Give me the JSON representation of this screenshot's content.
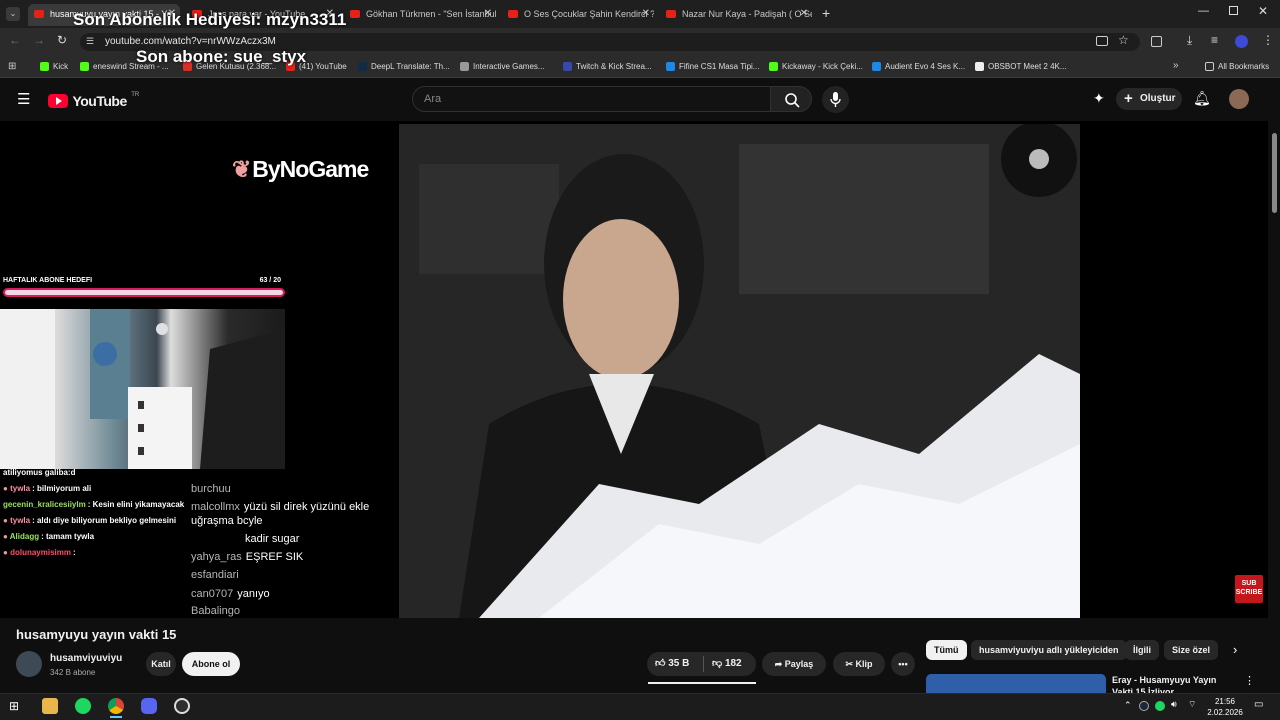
{
  "browser": {
    "tabs": [
      {
        "label": "husamyuyu yayın vakti 15 - Yo"
      },
      {
        "label": "Joss para var - YouTube"
      },
      {
        "label": "Gökhan Türkmen - \"Sen İstanbul"
      },
      {
        "label": "O Ses Çocuklar Şahin Kendirci ?"
      },
      {
        "label": "Nazar Nur Kaya - Padişah ( O Se"
      }
    ],
    "url": "youtube.com/watch?v=nrWWzAczx3M",
    "bookmarks": [
      "Kick",
      "eneswind Stream - ...",
      "Gelen Kutusu (2.368...",
      "(41) YouTube",
      "DeepL Translate: Th...",
      "Interactive Games...",
      "Twitch & Kick Strea...",
      "Fifine CS1 Masa Tipi...",
      "Kickaway - Kick Çeki...",
      "Audient Evo 4 Ses K...",
      "OBSBOT Meet 2 4K..."
    ],
    "all_bookmarks": "All Bookmarks"
  },
  "youtube": {
    "logo_text": "YouTube",
    "logo_region": "TR",
    "search_placeholder": "Ara",
    "create_label": "Oluştur"
  },
  "stream": {
    "overlay_top": "Son Abonelik Hediyesi: mzyn3311",
    "overlay_second": "Son abone: sue_styx",
    "sponsor": "ByNoGame",
    "goal_label": "HAFTALIK ABONE HEDEFI",
    "goal_count": "63  / 20",
    "goal_progress": 1.0,
    "side_chat": [
      {
        "user": "",
        "text": "atiliyomus galiba:d",
        "color": "#ffffff"
      },
      {
        "user": "tywla",
        "text": ": bilmiyorum ali",
        "color": "#ff8fa3"
      },
      {
        "user": "gecenin_kralicesiiylm",
        "text": ": Kesin elini yikamayacak",
        "color": "#9be15d"
      },
      {
        "user": "tywla",
        "text": ": aldı diye biliyorum bekliyo gelmesini",
        "color": "#ff8fa3"
      },
      {
        "user": "Alidagg",
        "text": ": tamam tywla",
        "color": "#9be15d"
      },
      {
        "user": "dolunaymisimm",
        "text": ": ",
        "color": "#ff4d6d"
      }
    ],
    "overlay_chat": [
      {
        "user": "burchuu",
        "text": ""
      },
      {
        "user": "malcollmx",
        "text": "yüzü sil direk yüzünü ekle"
      },
      {
        "user": "",
        "text": "uğraşma bcyle"
      },
      {
        "user": "",
        "text": "kadir sugar"
      },
      {
        "user": "yahya_ras",
        "text": "EŞREF SIK"
      },
      {
        "user": "esfandiari",
        "text": ""
      },
      {
        "user": "can0707",
        "text": "yanıyo"
      },
      {
        "user": "Babalingo",
        "text": ""
      }
    ],
    "subscribe_badge": "SUB SCRIBE"
  },
  "video": {
    "title": "husamyuyu yayın vakti 15",
    "channel": "husamviyuviyu",
    "subscribers": "342 B abone",
    "join_label": "Katıl",
    "subscribe_label": "Abone ol",
    "likes": "35 B",
    "dislikes": "182",
    "share_label": "Paylaş",
    "clip_label": "Klip"
  },
  "related": {
    "chips": [
      "Tümü",
      "husamviyuviyu adlı yükleyiciden",
      "İlgili",
      "Size özel"
    ],
    "first_title": "Eray - Husamyuyu Yayın Vakti 15 İzliyor"
  },
  "taskbar": {
    "time": "21:56",
    "date": "2.02.2026"
  }
}
